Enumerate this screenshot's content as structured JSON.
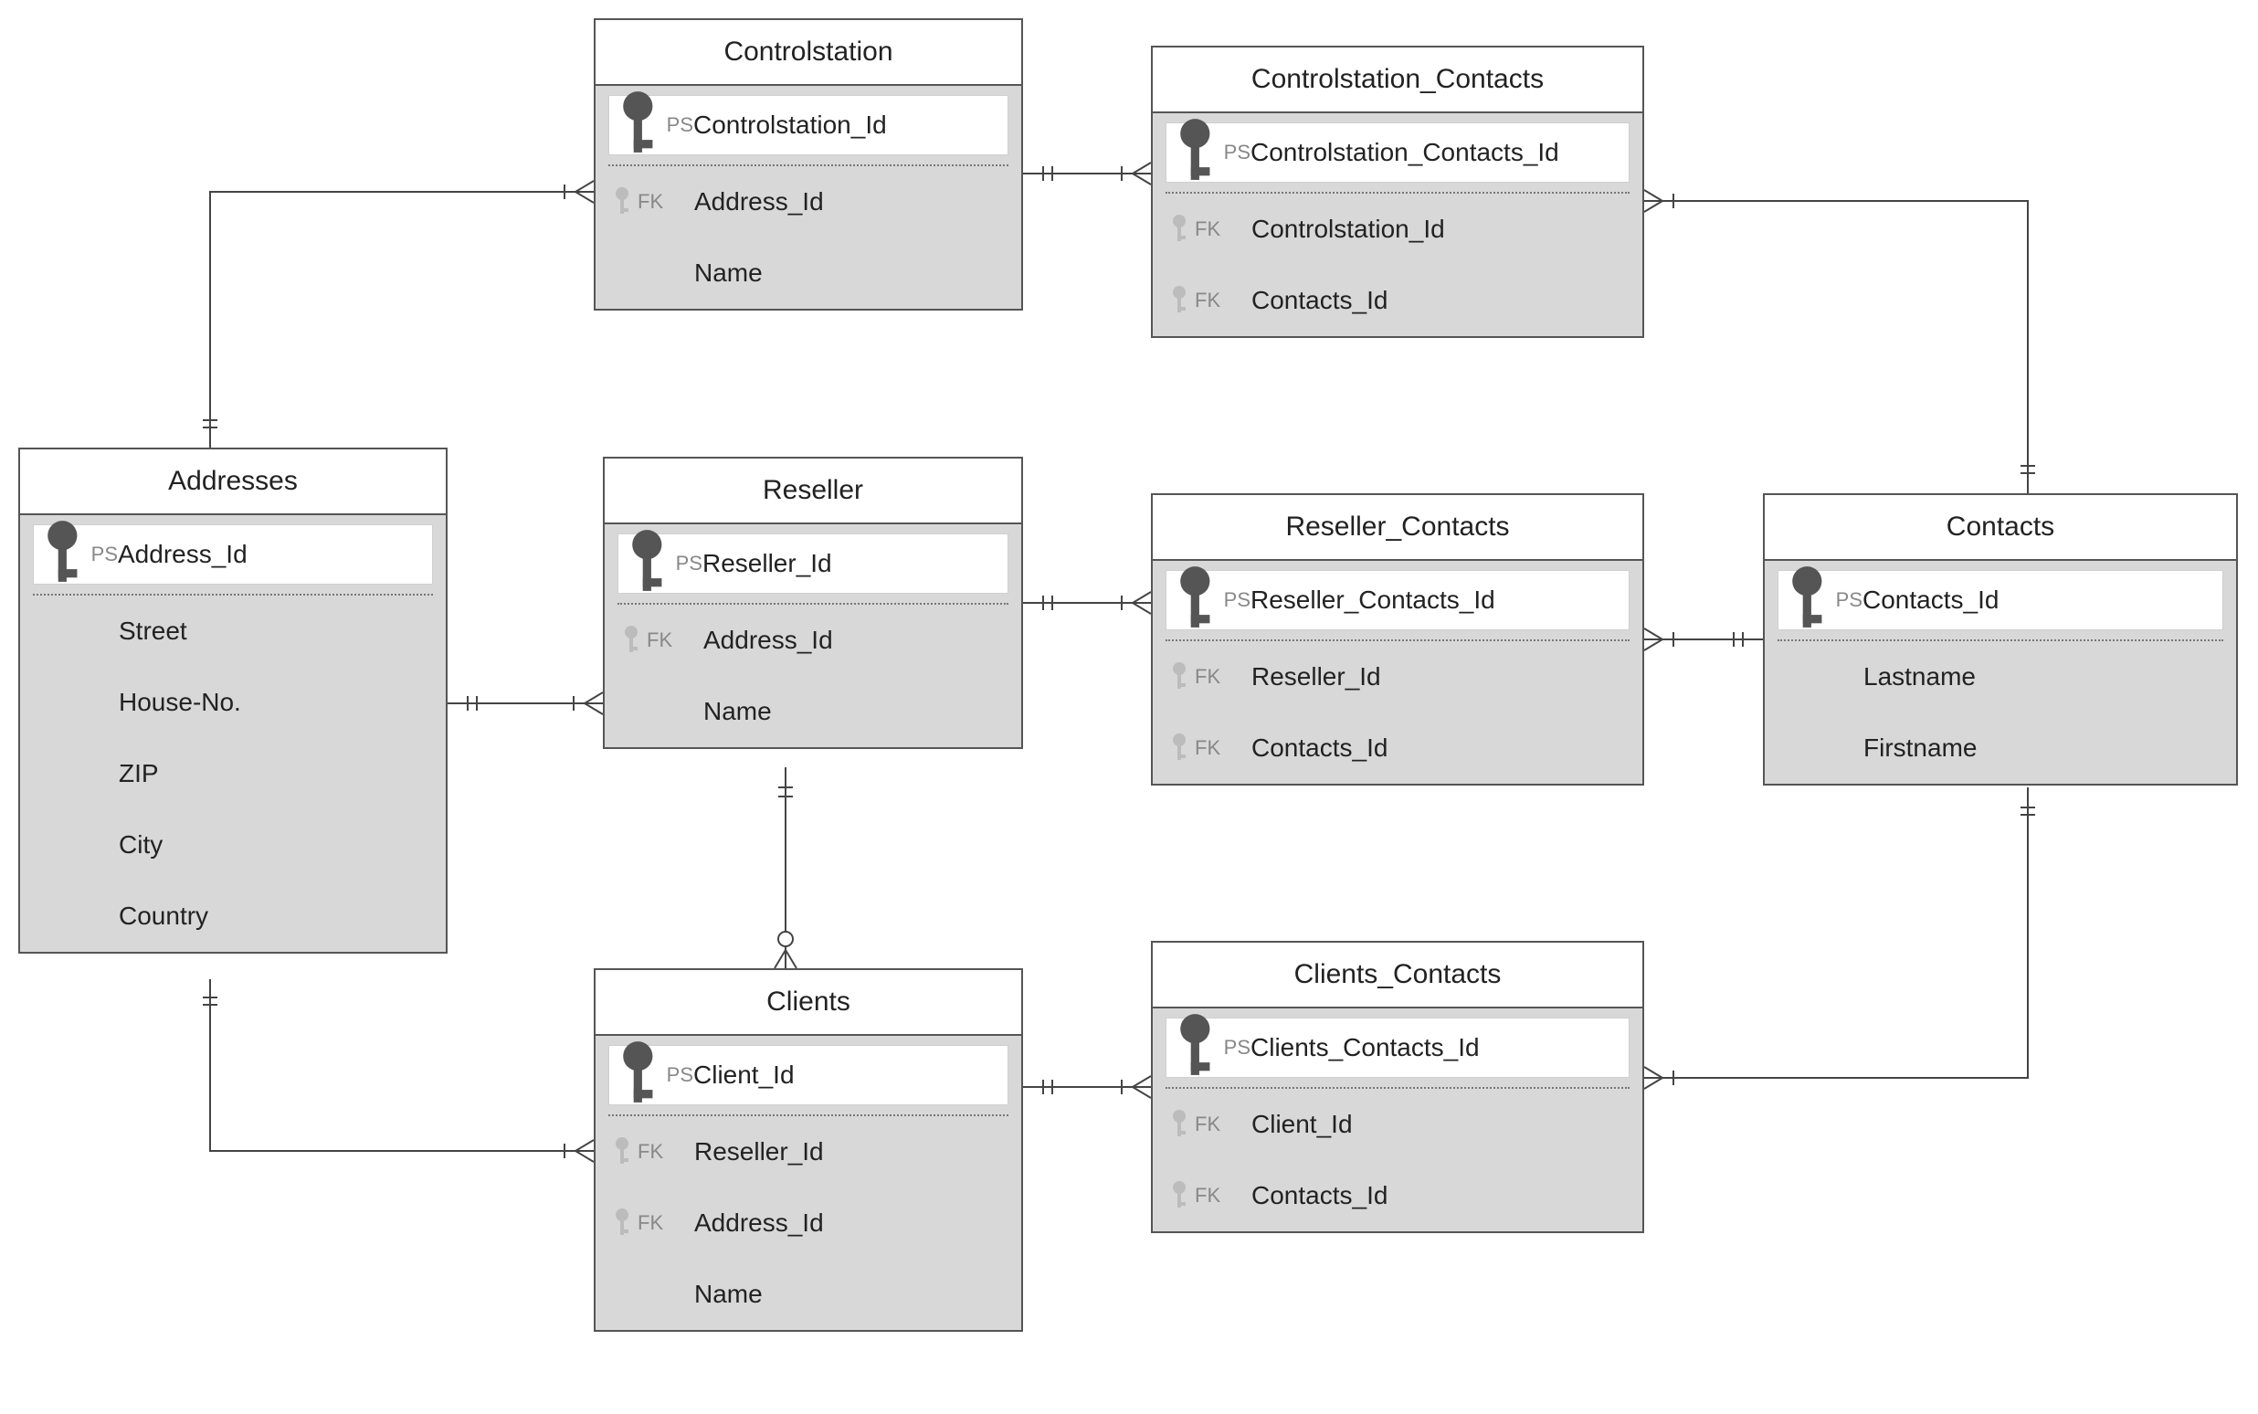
{
  "entities": {
    "addresses": {
      "title": "Addresses",
      "pk": {
        "tag": "PS",
        "label": "Address_Id"
      },
      "rows": [
        {
          "tag": "",
          "label": "Street"
        },
        {
          "tag": "",
          "label": "House-No."
        },
        {
          "tag": "",
          "label": "ZIP"
        },
        {
          "tag": "",
          "label": "City"
        },
        {
          "tag": "",
          "label": "Country"
        }
      ]
    },
    "controlstation": {
      "title": "Controlstation",
      "pk": {
        "tag": "PS",
        "label": "Controlstation_Id"
      },
      "rows": [
        {
          "tag": "FK",
          "label": "Address_Id"
        },
        {
          "tag": "",
          "label": "Name"
        }
      ]
    },
    "controlstation_contacts": {
      "title": "Controlstation_Contacts",
      "pk": {
        "tag": "PS",
        "label": "Controlstation_Contacts_Id"
      },
      "rows": [
        {
          "tag": "FK",
          "label": "Controlstation_Id"
        },
        {
          "tag": "FK",
          "label": "Contacts_Id"
        }
      ]
    },
    "reseller": {
      "title": "Reseller",
      "pk": {
        "tag": "PS",
        "label": "Reseller_Id"
      },
      "rows": [
        {
          "tag": "FK",
          "label": "Address_Id"
        },
        {
          "tag": "",
          "label": "Name"
        }
      ]
    },
    "reseller_contacts": {
      "title": "Reseller_Contacts",
      "pk": {
        "tag": "PS",
        "label": "Reseller_Contacts_Id"
      },
      "rows": [
        {
          "tag": "FK",
          "label": "Reseller_Id"
        },
        {
          "tag": "FK",
          "label": "Contacts_Id"
        }
      ]
    },
    "contacts": {
      "title": "Contacts",
      "pk": {
        "tag": "PS",
        "label": "Contacts_Id"
      },
      "rows": [
        {
          "tag": "",
          "label": "Lastname"
        },
        {
          "tag": "",
          "label": "Firstname"
        }
      ]
    },
    "clients": {
      "title": "Clients",
      "pk": {
        "tag": "PS",
        "label": "Client_Id"
      },
      "rows": [
        {
          "tag": "FK",
          "label": "Reseller_Id"
        },
        {
          "tag": "FK",
          "label": "Address_Id"
        },
        {
          "tag": "",
          "label": "Name"
        }
      ]
    },
    "clients_contacts": {
      "title": "Clients_Contacts",
      "pk": {
        "tag": "PS",
        "label": "Clients_Contacts_Id"
      },
      "rows": [
        {
          "tag": "FK",
          "label": "Client_Id"
        },
        {
          "tag": "FK",
          "label": "Contacts_Id"
        }
      ]
    }
  }
}
